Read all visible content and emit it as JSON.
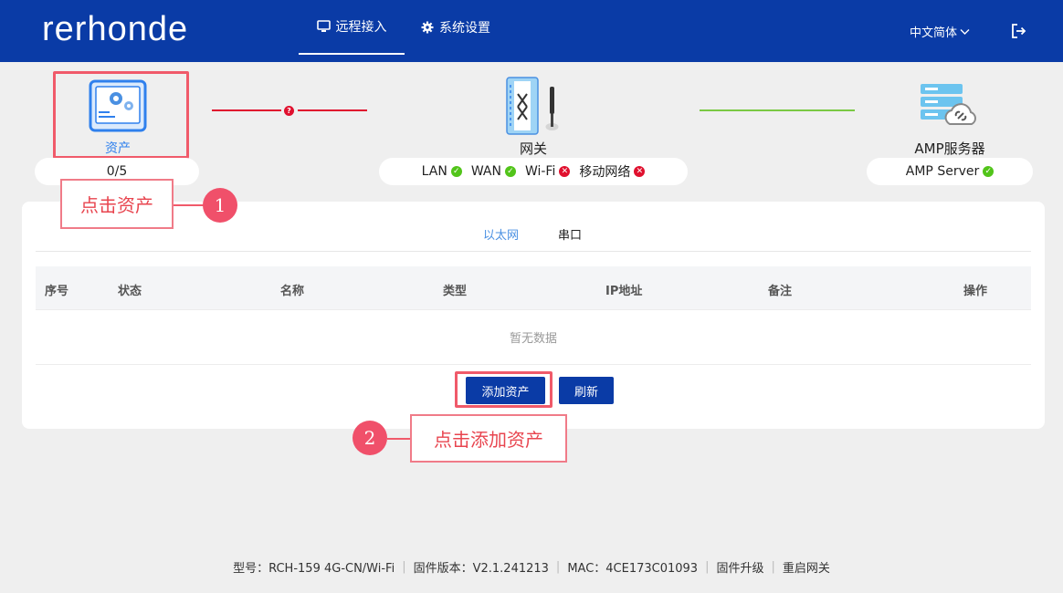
{
  "header": {
    "logo": "rerhonde",
    "nav": [
      {
        "label": "远程接入",
        "active": true
      },
      {
        "label": "系统设置",
        "active": false
      }
    ],
    "language": "中文简体"
  },
  "topology": {
    "asset": {
      "label": "资产",
      "count": "0/5"
    },
    "gateway": {
      "label": "网关",
      "status": [
        {
          "label": "LAN",
          "ok": true
        },
        {
          "label": "WAN",
          "ok": true
        },
        {
          "label": "Wi-Fi",
          "ok": false
        },
        {
          "label": "移动网络",
          "ok": false
        }
      ]
    },
    "amp": {
      "label": "AMP服务器",
      "status_label": "AMP Server",
      "ok": true
    },
    "link_asset_gateway": "error",
    "link_gateway_amp": "ok"
  },
  "annotations": [
    {
      "number": "1",
      "text": "点击资产"
    },
    {
      "number": "2",
      "text": "点击添加资产"
    }
  ],
  "tabs": [
    {
      "label": "以太网",
      "active": true
    },
    {
      "label": "串口",
      "active": false
    }
  ],
  "table": {
    "columns": [
      "序号",
      "状态",
      "名称",
      "类型",
      "IP地址",
      "备注",
      "操作"
    ],
    "empty_text": "暂无数据"
  },
  "buttons": {
    "add_asset": "添加资产",
    "refresh": "刷新"
  },
  "footer": [
    "型号：RCH-159  4G-CN/Wi-Fi",
    "固件版本：V2.1.241213",
    "MAC：4CE173C01093",
    "固件升级",
    "重启网关"
  ],
  "colors": {
    "primary": "#0a3ba6",
    "accent": "#2f80ed",
    "ok": "#52c41a",
    "error": "#e0102e",
    "highlight": "#f05a6a"
  }
}
